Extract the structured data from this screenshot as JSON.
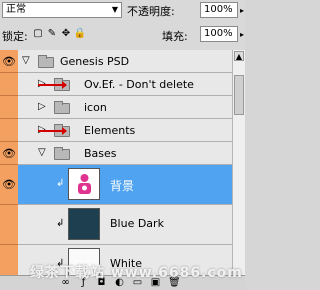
{
  "blend_mode": "正常",
  "opacity": {
    "label": "不透明度:",
    "value": "100%"
  },
  "lock": {
    "label": "锁定:"
  },
  "fill": {
    "label": "填充:",
    "value": "100%"
  },
  "layers": [
    {
      "name": "Genesis PSD",
      "type": "group",
      "expanded": true
    },
    {
      "name": "Ov.Ef. - Don't delete",
      "type": "group",
      "expanded": false
    },
    {
      "name": "icon",
      "type": "group",
      "expanded": false
    },
    {
      "name": "Elements",
      "type": "group",
      "expanded": false
    },
    {
      "name": "Bases",
      "type": "group",
      "expanded": true
    },
    {
      "name": "背景",
      "type": "layer",
      "selected": true
    },
    {
      "name": "Blue Dark",
      "type": "layer"
    },
    {
      "name": "White",
      "type": "layer"
    }
  ],
  "watermark": "绿茶下载站 www.6686.com",
  "colors": {
    "eye_column": "#f4a060",
    "selection": "#4fa3f0",
    "arrow": "#d40000",
    "blue_dark": "#1e3f4f"
  }
}
